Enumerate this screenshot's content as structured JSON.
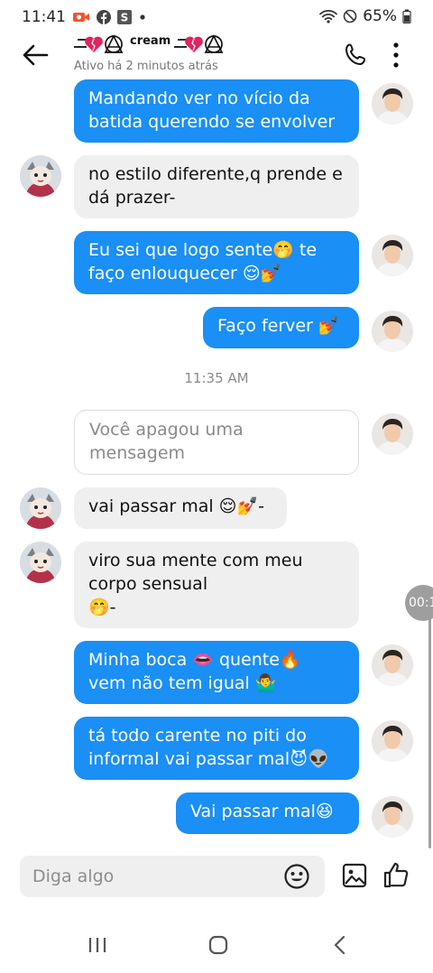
{
  "status_bar": {
    "time": "11:41",
    "battery": "65%",
    "icons": [
      "video-camera-icon",
      "facebook-icon",
      "app-s-icon",
      "dot-icon",
      "wifi-icon",
      "do-not-disturb-icon",
      "battery-icon"
    ]
  },
  "header": {
    "title": "cream",
    "subtitle": "Ativo há 2 minutos atrás",
    "back_icon": "arrow-left-icon",
    "call_icon": "phone-icon",
    "more_icon": "more-vertical-icon"
  },
  "messages": [
    {
      "side": "out",
      "text": "Mandando ver no vício da\nbatida querendo se envolver"
    },
    {
      "side": "in",
      "text": "no estilo diferente,q prende e\ndá prazer-"
    },
    {
      "side": "out",
      "text": "Eu sei que logo sente🤭 te\nfaço enlouquecer 😌💅"
    },
    {
      "side": "out",
      "text": "Faço ferver 💅"
    },
    {
      "side": "out",
      "type": "deleted",
      "text": "Você apagou uma\nmensagem"
    },
    {
      "side": "in",
      "text": "vai passar mal 😌💅-"
    },
    {
      "side": "in",
      "text": "viro sua mente com meu\ncorpo sensual\n🤭-"
    },
    {
      "side": "out",
      "text": "Minha boca 👄 quente🔥\nvem não tem igual 🤷‍♂️"
    },
    {
      "side": "out",
      "text": "tá todo carente no piti do\ninformal vai passar mal😈👽"
    },
    {
      "side": "out",
      "text": "Vai passar mal😆"
    }
  ],
  "timestamp": "11:35 AM",
  "timer": "00:1",
  "composer": {
    "placeholder": "Diga algo",
    "emoji_icon": "smiley-icon",
    "image_icon": "image-icon",
    "like_icon": "thumbs-up-icon"
  },
  "nav_bar": {
    "icons": [
      "recent-apps-icon",
      "home-icon",
      "back-icon"
    ]
  },
  "colors": {
    "outgoing_bubble": "#1a8ff5",
    "incoming_bubble": "#efefef",
    "accent": "#1a8ff5"
  }
}
